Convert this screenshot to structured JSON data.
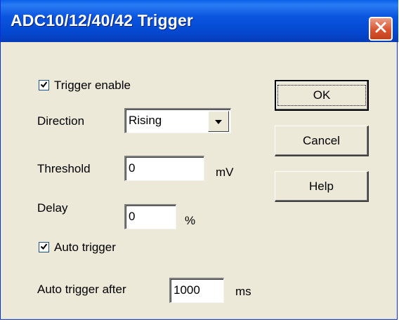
{
  "window": {
    "title": "ADC10/12/40/42 Trigger"
  },
  "trigger_enable": {
    "label": "Trigger enable",
    "checked": true
  },
  "direction": {
    "label": "Direction",
    "value": "Rising"
  },
  "threshold": {
    "label": "Threshold",
    "value": "0",
    "unit": "mV"
  },
  "delay": {
    "label": "Delay",
    "value": "0",
    "unit": "%"
  },
  "auto_trigger": {
    "label": "Auto trigger",
    "checked": true
  },
  "auto_trigger_after": {
    "label": "Auto trigger after",
    "value": "1000",
    "unit": "ms"
  },
  "buttons": {
    "ok": "OK",
    "cancel": "Cancel",
    "help": "Help"
  },
  "icons": {
    "close": "close-icon",
    "check": "checkmark-icon",
    "dropdown": "chevron-down-icon"
  }
}
